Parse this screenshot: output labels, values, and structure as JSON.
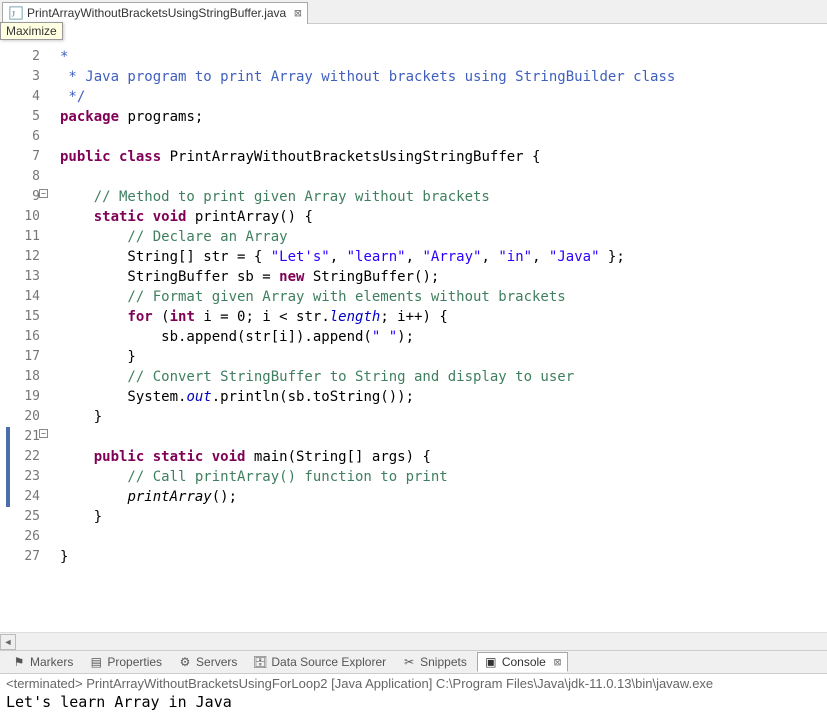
{
  "tab": {
    "filename": "PrintArrayWithoutBracketsUsingStringBuffer.java"
  },
  "hint": "Maximize",
  "gutter": {
    "lines": [
      "",
      "2",
      "3",
      "4",
      "5",
      "6",
      "7",
      "8",
      "9",
      "10",
      "11",
      "12",
      "13",
      "14",
      "15",
      "16",
      "17",
      "18",
      "19",
      "20",
      "21",
      "22",
      "23",
      "24",
      "25",
      "26",
      "27"
    ]
  },
  "code": {
    "l1a": "*",
    "l1b": "",
    "l2": " * Java program to print Array without brackets using StringBuilder class",
    "l3": " */",
    "l4_kw": "package",
    "l4": " programs;",
    "l5": "",
    "l6_kw1": "public",
    "l6_kw2": "class",
    "l6_name": "PrintArrayWithoutBracketsUsingStringBuffer",
    "l6_b": " {",
    "l7": "",
    "l8": "    // Method to print given Array without brackets",
    "l9_kw1": "static",
    "l9_kw2": "void",
    "l9": "    ",
    "l9_m": " printArray() {",
    "l10": "        // Declare an Array",
    "l11a": "        String[] str = { ",
    "l11s1": "\"Let's\"",
    "l11c": ", ",
    "l11s2": "\"learn\"",
    "l11s3": "\"Array\"",
    "l11s4": "\"in\"",
    "l11s5": "\"Java\"",
    "l11e": " };",
    "l12a": "        StringBuffer sb = ",
    "l12_kw": "new",
    "l12b": " StringBuffer();",
    "l13": "        // Format given Array with elements without brackets",
    "l14a": "        ",
    "l14_kw": "for",
    "l14b": " (",
    "l14_kw2": "int",
    "l14c": " i = 0; i < str.",
    "l14_f": "length",
    "l14d": "; i++) {",
    "l15a": "            sb.append(str[i]).append(",
    "l15s": "\" \"",
    "l15b": ");",
    "l16": "        }",
    "l17": "        // Convert StringBuffer to String and display to user",
    "l18a": "        System.",
    "l18_f": "out",
    "l18b": ".println(sb.toString());",
    "l19": "    }",
    "l20": "",
    "l21a": "    ",
    "l21_kw1": "public",
    "l21_kw2": "static",
    "l21_kw3": "void",
    "l21b": " main(String[] args) {",
    "l22": "        // Call printArray() function to print",
    "l23": "        ",
    "l23_m": "printArray",
    "l23b": "();",
    "l24": "    }",
    "l25": "",
    "l26": "}",
    "l27": ""
  },
  "bottom_tabs": {
    "markers": "Markers",
    "properties": "Properties",
    "servers": "Servers",
    "dse": "Data Source Explorer",
    "snippets": "Snippets",
    "console": "Console"
  },
  "console": {
    "header": "<terminated> PrintArrayWithoutBracketsUsingForLoop2 [Java Application] C:\\Program Files\\Java\\jdk-11.0.13\\bin\\javaw.exe",
    "output": "Let's learn Array in Java "
  }
}
